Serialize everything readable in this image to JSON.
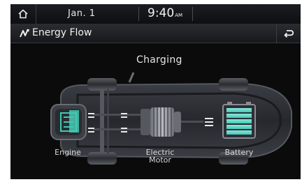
{
  "status": {
    "date": "Jan.  1",
    "time": "9:40",
    "ampm": "AM"
  },
  "title": {
    "label": "Energy Flow"
  },
  "flow": {
    "state": "Charging",
    "engine_label": "Engine",
    "motor_label_line1": "Electric",
    "motor_label_line2": "Motor",
    "battery_label": "Battery"
  },
  "colors": {
    "accent": "#3ec9b8",
    "screen_bg": "#0b0b0c"
  },
  "icons": {
    "home": "home-icon",
    "energy_flow": "energy-flow-icon",
    "back": "back-icon"
  }
}
